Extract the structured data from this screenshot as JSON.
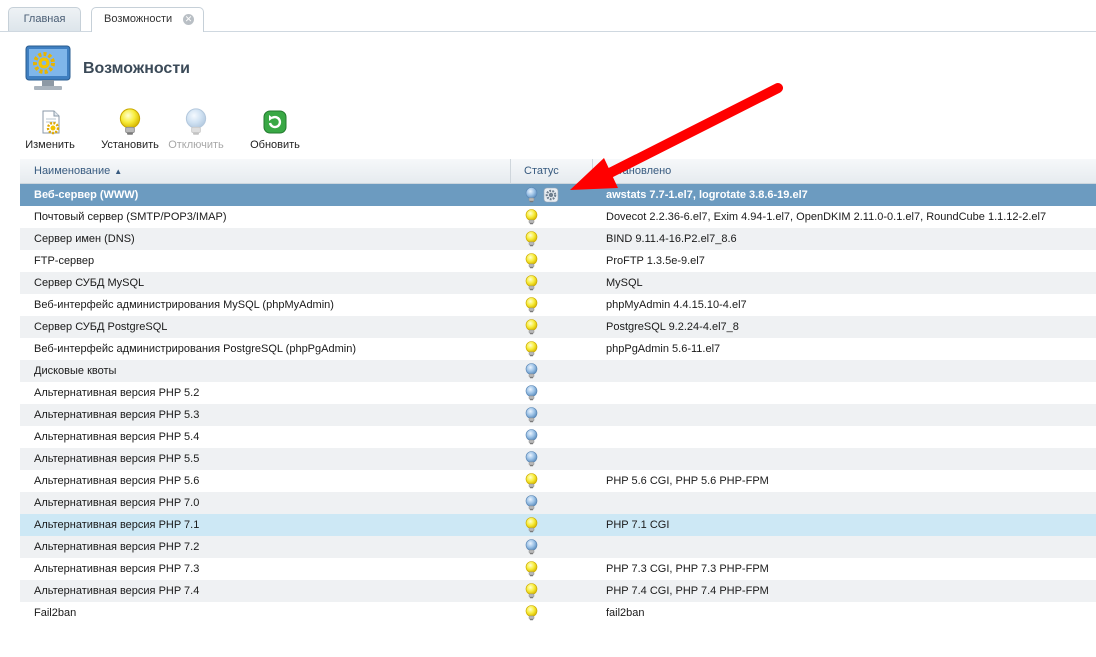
{
  "tabs": [
    {
      "label": "Главная",
      "active": false
    },
    {
      "label": "Возможности",
      "active": true
    }
  ],
  "page": {
    "title": "Возможности",
    "icon": "monitor-gear-icon"
  },
  "toolbar": [
    {
      "label": "Изменить",
      "icon": "edit-document-icon",
      "enabled": true
    },
    {
      "label": "Установить",
      "icon": "lightbulb-on-icon",
      "enabled": true
    },
    {
      "label": "Отключить",
      "icon": "lightbulb-off-icon",
      "enabled": false
    },
    {
      "label": "Обновить",
      "icon": "refresh-icon",
      "enabled": true
    }
  ],
  "table": {
    "columns": [
      {
        "label": "Наименование",
        "sort": "asc"
      },
      {
        "label": "Статус"
      },
      {
        "label": "Установлено"
      }
    ],
    "rows": [
      {
        "name": "Веб-сервер (WWW)",
        "status": "off",
        "busy": true,
        "installed": "awstats 7.7-1.el7, logrotate 3.8.6-19.el7",
        "state": "selected"
      },
      {
        "name": "Почтовый сервер (SMTP/POP3/IMAP)",
        "status": "on",
        "installed": "Dovecot 2.2.36-6.el7, Exim 4.94-1.el7, OpenDKIM 2.11.0-0.1.el7, RoundCube 1.1.12-2.el7"
      },
      {
        "name": "Сервер имен (DNS)",
        "status": "on",
        "installed": "BIND 9.11.4-16.P2.el7_8.6"
      },
      {
        "name": "FTP-сервер",
        "status": "on",
        "installed": "ProFTP 1.3.5e-9.el7"
      },
      {
        "name": "Сервер СУБД MySQL",
        "status": "on",
        "installed": "MySQL"
      },
      {
        "name": "Веб-интерфейс администрирования MySQL (phpMyAdmin)",
        "status": "on",
        "installed": "phpMyAdmin 4.4.15.10-4.el7"
      },
      {
        "name": "Сервер СУБД PostgreSQL",
        "status": "on",
        "installed": "PostgreSQL 9.2.24-4.el7_8"
      },
      {
        "name": "Веб-интерфейс администрирования PostgreSQL (phpPgAdmin)",
        "status": "on",
        "installed": "phpPgAdmin 5.6-11.el7"
      },
      {
        "name": "Дисковые квоты",
        "status": "off",
        "installed": ""
      },
      {
        "name": "Альтернативная версия PHP 5.2",
        "status": "off",
        "installed": ""
      },
      {
        "name": "Альтернативная версия PHP 5.3",
        "status": "off",
        "installed": ""
      },
      {
        "name": "Альтернативная версия PHP 5.4",
        "status": "off",
        "installed": ""
      },
      {
        "name": "Альтернативная версия PHP 5.5",
        "status": "off",
        "installed": ""
      },
      {
        "name": "Альтернативная версия PHP 5.6",
        "status": "on",
        "installed": "PHP 5.6 CGI, PHP 5.6 PHP-FPM"
      },
      {
        "name": "Альтернативная версия PHP 7.0",
        "status": "off",
        "installed": ""
      },
      {
        "name": "Альтернативная версия PHP 7.1",
        "status": "on",
        "installed": "PHP 7.1 CGI",
        "state": "highlight"
      },
      {
        "name": "Альтернативная версия PHP 7.2",
        "status": "off",
        "installed": ""
      },
      {
        "name": "Альтернативная версия PHP 7.3",
        "status": "on",
        "installed": "PHP 7.3 CGI, PHP 7.3 PHP-FPM"
      },
      {
        "name": "Альтернативная версия PHP 7.4",
        "status": "on",
        "installed": "PHP 7.4 CGI, PHP 7.4 PHP-FPM"
      },
      {
        "name": "Fail2ban",
        "status": "on",
        "installed": "fail2ban"
      }
    ]
  },
  "colors": {
    "selected_row": "#6c9bc0",
    "highlight_row": "#cde8f5",
    "annotation_arrow": "#ff0000"
  }
}
